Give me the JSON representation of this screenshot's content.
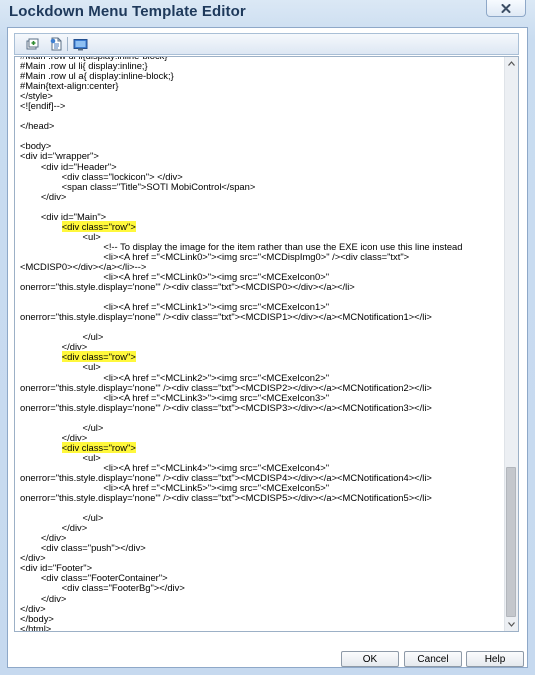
{
  "window": {
    "title": "Lockdown Menu Template Editor",
    "close_icon": "close-icon"
  },
  "toolbar": {
    "buttons": [
      {
        "name": "insert-macro",
        "icon": "insert-macro-icon"
      },
      {
        "name": "insert-item",
        "icon": "insert-item-icon"
      },
      {
        "name": "preview",
        "icon": "preview-icon"
      }
    ]
  },
  "code_lines": [
    "#Main .row ul li{display:inline-block}",
    "#Main .row ul li{ display:inline;}",
    "#Main .row ul a{ display:inline-block;}",
    "#Main{text-align:center}",
    "</style>",
    "<![endif]-->",
    "",
    "</head>",
    "",
    "<body>",
    "<div id=\"wrapper\">",
    "        <div id=\"Header\">",
    "                <div class=\"lockicon\"> </div>",
    "                <span class=\"Title\">SOTI MobiControl</span>",
    "        </div>",
    "",
    "        <div id=\"Main\">",
    "                <div class=\"row\">",
    "                        <ul>",
    "                                <!-- To display the image for the item rather than use the EXE icon use this line instead",
    "                                <li><A href =\"<MCLink0>\"><img src=\"<MCDispImg0>\" /><div class=\"txt\">",
    "<MCDISP0></div></a></li>-->",
    "                                <li><A href =\"<MCLink0>\"><img src=\"<MCExeIcon0>\"",
    "onerror=\"this.style.display='none'\" /><div class=\"txt\"><MCDISP0></div></a></li>",
    "",
    "                                <li><A href =\"<MCLink1>\"><img src=\"<MCExeIcon1>\"",
    "onerror=\"this.style.display='none'\" /><div class=\"txt\"><MCDISP1></div></a><MCNotification1></li>",
    "",
    "                        </ul>",
    "                </div>",
    "                <div class=\"row\">",
    "                        <ul>",
    "                                <li><A href =\"<MCLink2>\"><img src=\"<MCExeIcon2>\"",
    "onerror=\"this.style.display='none'\" /><div class=\"txt\"><MCDISP2></div></a><MCNotification2></li>",
    "                                <li><A href =\"<MCLink3>\"><img src=\"<MCExeIcon3>\"",
    "onerror=\"this.style.display='none'\" /><div class=\"txt\"><MCDISP3></div></a><MCNotification3></li>",
    "",
    "                        </ul>",
    "                </div>",
    "                <div class=\"row\">",
    "                        <ul>",
    "                                <li><A href =\"<MCLink4>\"><img src=\"<MCExeIcon4>\"",
    "onerror=\"this.style.display='none'\" /><div class=\"txt\"><MCDISP4></div></a><MCNotification4></li>",
    "                                <li><A href =\"<MCLink5>\"><img src=\"<MCExeIcon5>\"",
    "onerror=\"this.style.display='none'\" /><div class=\"txt\"><MCDISP5></div></a><MCNotification5></li>",
    "",
    "                        </ul>",
    "                </div>",
    "        </div>",
    "        <div class=\"push\"></div>",
    "</div>",
    "<div id=\"Footer\">",
    "        <div class=\"FooterContainer\">",
    "                <div class=\"FooterBg\"></div>",
    "        </div>",
    "</div>",
    "</body>",
    "</html>"
  ],
  "highlight_text": "<div class=\"row\">",
  "highlight_color": "#fff83c",
  "buttons": {
    "ok": "OK",
    "cancel": "Cancel",
    "help": "Help"
  }
}
